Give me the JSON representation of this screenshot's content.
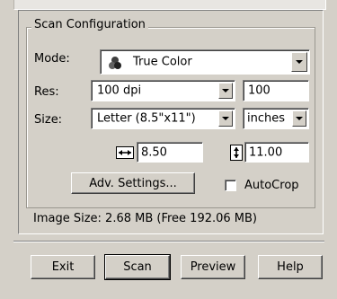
{
  "group": {
    "title": "Scan Configuration"
  },
  "mode": {
    "label": "Mode:",
    "value": "True Color",
    "icon": "color-mode-icon"
  },
  "res": {
    "label": "Res:",
    "select_value": "100 dpi",
    "input_value": "100"
  },
  "size": {
    "label": "Size:",
    "paper_value": "Letter (8.5\"x11\")",
    "unit_value": "inches"
  },
  "dims": {
    "width_value": "8.50",
    "height_value": "11.00",
    "width_icon": "width-arrows-icon",
    "height_icon": "height-arrows-icon"
  },
  "adv_settings": {
    "label": "Adv. Settings..."
  },
  "autocrop": {
    "label": "AutoCrop",
    "checked": false
  },
  "image_size": {
    "text": "Image Size: 2.68 MB (Free 192.06 MB)"
  },
  "buttons": {
    "exit": "Exit",
    "scan": "Scan",
    "preview": "Preview",
    "help": "Help"
  }
}
